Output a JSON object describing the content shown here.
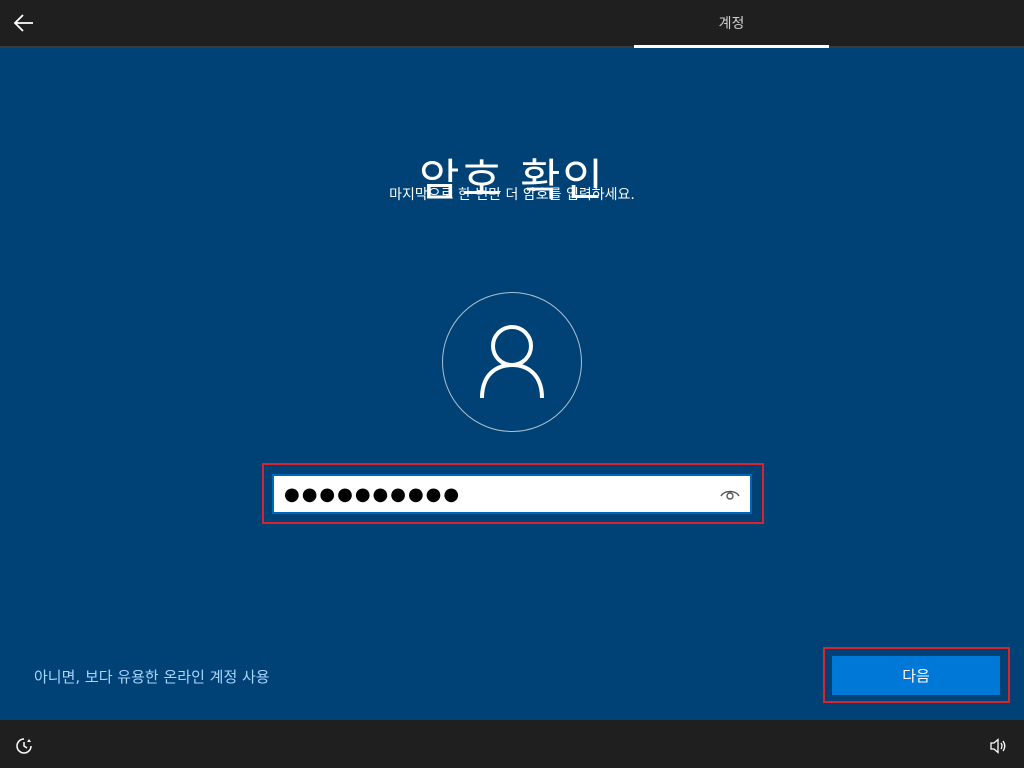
{
  "header": {
    "back_icon": "arrow-left-icon",
    "tab_label": "계정"
  },
  "main": {
    "title": "암호 확인",
    "subtitle": "마지막으로 한 번만 더 암호를 입력하세요.",
    "avatar_icon": "user-icon",
    "password": {
      "value": "●●●●●●●●●●",
      "reveal_icon": "eye-icon"
    }
  },
  "footer": {
    "alt_link": "아니면, 보다 유용한 온라인 계정 사용",
    "next_label": "다음"
  },
  "taskbar": {
    "accessibility_icon": "accessibility-icon",
    "volume_icon": "volume-icon"
  },
  "colors": {
    "background": "#004275",
    "accent": "#0078d7",
    "highlight": "#d9232e",
    "link": "#a8d4ff"
  }
}
